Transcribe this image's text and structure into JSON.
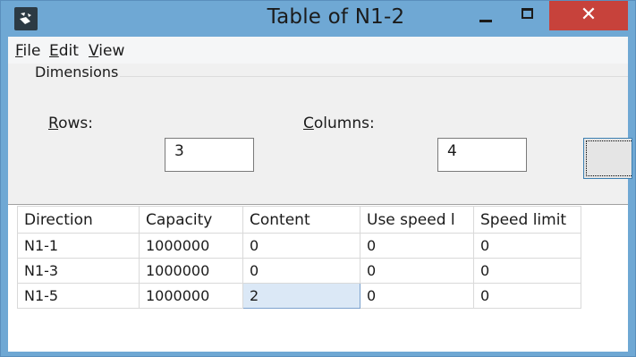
{
  "window": {
    "title": "Table of N1-2",
    "close_glyph": "✕"
  },
  "menu": {
    "file": {
      "mnemonic": "F",
      "rest": "ile"
    },
    "edit": {
      "mnemonic": "E",
      "rest": "dit"
    },
    "view": {
      "mnemonic": "V",
      "rest": "iew"
    }
  },
  "dimensions": {
    "group_label": "Dimensions",
    "rows_label_mnemonic": "R",
    "rows_label_rest": "ows:",
    "rows_value": "3",
    "columns_label_mnemonic": "C",
    "columns_label_rest": "olumns:",
    "columns_value": "4",
    "apply_label": ""
  },
  "table": {
    "headers": [
      "Direction",
      "Capacity",
      "Content",
      "Use speed l",
      "Speed limit"
    ],
    "rows": [
      [
        "N1-1",
        "1000000",
        "0",
        "0",
        "0"
      ],
      [
        "N1-3",
        "1000000",
        "0",
        "0",
        "0"
      ],
      [
        "N1-5",
        "1000000",
        "2",
        "0",
        "0"
      ]
    ],
    "selected_cell": {
      "row": 2,
      "col": 2
    }
  },
  "colors": {
    "titlebar": "#6fa8d4",
    "close_button": "#c7423b",
    "selection": "#dbe8f6"
  }
}
